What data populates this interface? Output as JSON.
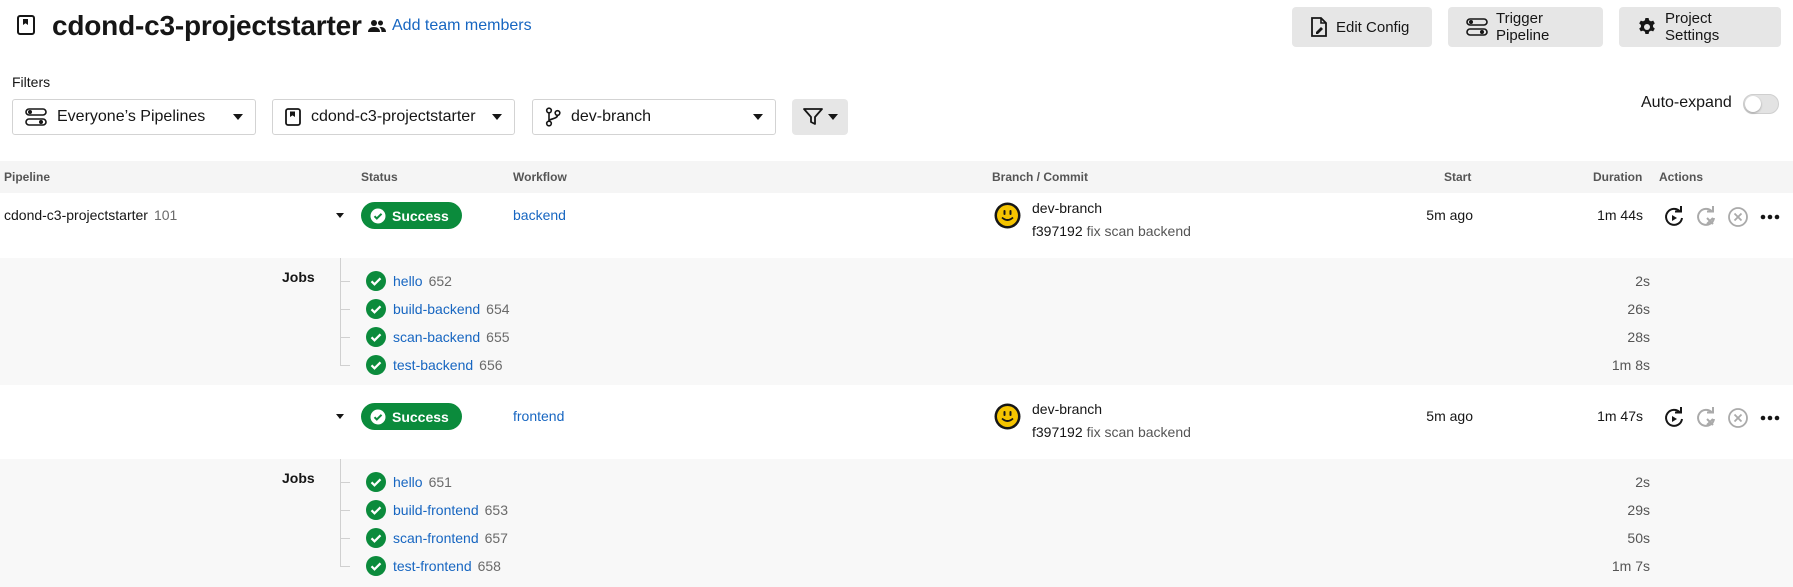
{
  "header": {
    "project_title": "cdond-c3-projectstarter",
    "add_team_label": "Add team members",
    "edit_config_label": "Edit Config",
    "trigger_pipeline_label": "Trigger Pipeline",
    "project_settings_label": "Project Settings"
  },
  "filters": {
    "label": "Filters",
    "pipelines_value": "Everyone’s Pipelines",
    "project_value": "cdond-c3-projectstarter",
    "branch_value": "dev-branch",
    "auto_expand_label": "Auto-expand",
    "auto_expand_on": false
  },
  "table": {
    "columns": [
      "Pipeline",
      "Status",
      "Workflow",
      "Branch / Commit",
      "Start",
      "Duration",
      "Actions"
    ]
  },
  "pipeline": {
    "name": "cdond-c3-projectstarter",
    "number": "101"
  },
  "workflows": [
    {
      "status": "Success",
      "name": "backend",
      "branch": "dev-branch",
      "commit_hash": "f397192",
      "commit_msg": "fix scan backend",
      "start": "5m ago",
      "duration": "1m 44s",
      "jobs_label": "Jobs",
      "jobs": [
        {
          "name": "hello",
          "num": "652",
          "duration": "2s"
        },
        {
          "name": "build-backend",
          "num": "654",
          "duration": "26s"
        },
        {
          "name": "scan-backend",
          "num": "655",
          "duration": "28s"
        },
        {
          "name": "test-backend",
          "num": "656",
          "duration": "1m 8s"
        }
      ]
    },
    {
      "status": "Success",
      "name": "frontend",
      "branch": "dev-branch",
      "commit_hash": "f397192",
      "commit_msg": "fix scan backend",
      "start": "5m ago",
      "duration": "1m 47s",
      "jobs_label": "Jobs",
      "jobs": [
        {
          "name": "hello",
          "num": "651",
          "duration": "2s"
        },
        {
          "name": "build-frontend",
          "num": "653",
          "duration": "29s"
        },
        {
          "name": "scan-frontend",
          "num": "657",
          "duration": "50s"
        },
        {
          "name": "test-frontend",
          "num": "658",
          "duration": "1m 7s"
        }
      ]
    }
  ],
  "colors": {
    "success": "#0b8b3c",
    "link": "#1766c1",
    "button_bg": "#e6e6e6"
  },
  "icons": [
    "project-icon",
    "people-icon",
    "edit-config-icon",
    "pipeline-icon",
    "gear-icon",
    "branch-icon",
    "filter-icon",
    "check-circle-icon",
    "avatar-smiley-icon",
    "rerun-icon",
    "rerun-failed-icon",
    "cancel-icon",
    "more-icon"
  ]
}
